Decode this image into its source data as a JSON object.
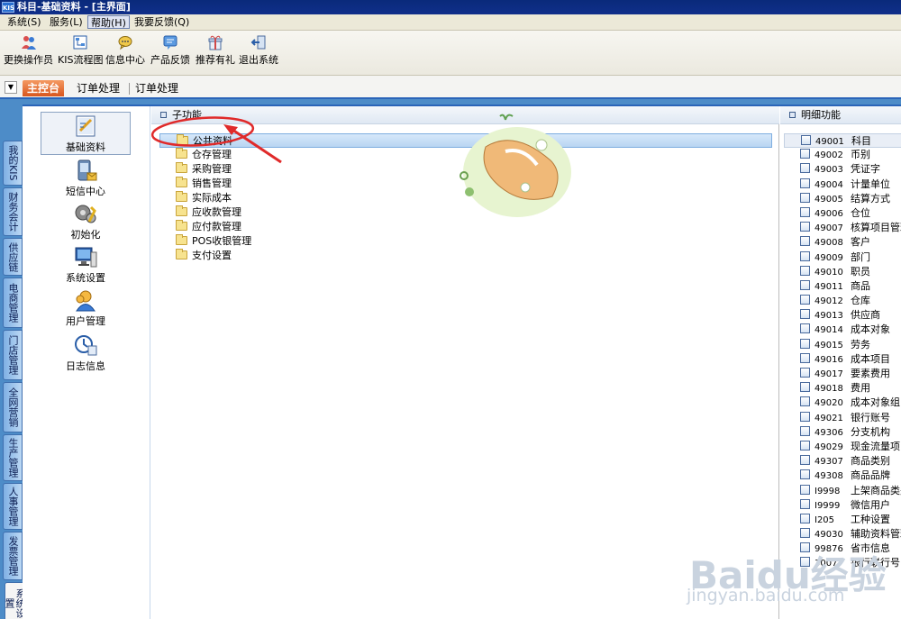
{
  "window": {
    "app_icon": "KIS",
    "title": "科目-基础资料 - [主界面]"
  },
  "menubar": {
    "items": [
      "系统(S)",
      "服务(L)",
      "帮助(H)",
      "我要反馈(Q)"
    ],
    "active_index": 2
  },
  "toolbar": {
    "buttons": [
      {
        "label": "更换操作员",
        "icon": "users-icon"
      },
      {
        "label": "KIS流程图",
        "icon": "flowchart-icon"
      },
      {
        "label": "信息中心",
        "icon": "message-icon"
      },
      {
        "label": "产品反馈",
        "icon": "feedback-icon"
      },
      {
        "label": "推荐有礼",
        "icon": "gift-icon"
      },
      {
        "label": "退出系统",
        "icon": "exit-icon"
      }
    ]
  },
  "tabs": {
    "items": [
      "主控台",
      "订单处理",
      "订单处理"
    ],
    "active_index": 0
  },
  "vertical_tabs": [
    "我的KIS",
    "财务会计",
    "供应链",
    "电商管理",
    "门店管理",
    "全网营销",
    "生产管理",
    "人事管理",
    "发票管理",
    "系统设置"
  ],
  "vertical_tabs_active": 9,
  "left_nav": {
    "items": [
      {
        "label": "基础资料",
        "icon": "basic-data-icon"
      },
      {
        "label": "短信中心",
        "icon": "sms-icon"
      },
      {
        "label": "初始化",
        "icon": "initialize-icon"
      },
      {
        "label": "系统设置",
        "icon": "system-settings-icon"
      },
      {
        "label": "用户管理",
        "icon": "user-management-icon"
      },
      {
        "label": "日志信息",
        "icon": "log-icon"
      }
    ],
    "selected_index": 0
  },
  "sub_functions": {
    "header": "子功能",
    "items": [
      "公共资料",
      "仓存管理",
      "采购管理",
      "销售管理",
      "实际成本",
      "应收款管理",
      "应付款管理",
      "POS收银管理",
      "支付设置"
    ],
    "selected_index": 0
  },
  "detail_functions": {
    "header": "明细功能",
    "items": [
      {
        "code": "49001",
        "name": "科目"
      },
      {
        "code": "49002",
        "name": "币别"
      },
      {
        "code": "49003",
        "name": "凭证字"
      },
      {
        "code": "49004",
        "name": "计量单位"
      },
      {
        "code": "49005",
        "name": "结算方式"
      },
      {
        "code": "49006",
        "name": "仓位"
      },
      {
        "code": "49007",
        "name": "核算项目管理"
      },
      {
        "code": "49008",
        "name": "客户"
      },
      {
        "code": "49009",
        "name": "部门"
      },
      {
        "code": "49010",
        "name": "职员"
      },
      {
        "code": "49011",
        "name": "商品"
      },
      {
        "code": "49012",
        "name": "仓库"
      },
      {
        "code": "49013",
        "name": "供应商"
      },
      {
        "code": "49014",
        "name": "成本对象"
      },
      {
        "code": "49015",
        "name": "劳务"
      },
      {
        "code": "49016",
        "name": "成本项目"
      },
      {
        "code": "49017",
        "name": "要素费用"
      },
      {
        "code": "49018",
        "name": "费用"
      },
      {
        "code": "49020",
        "name": "成本对象组"
      },
      {
        "code": "49021",
        "name": "银行账号"
      },
      {
        "code": "49306",
        "name": "分支机构"
      },
      {
        "code": "49029",
        "name": "现金流量项目"
      },
      {
        "code": "49307",
        "name": "商品类别"
      },
      {
        "code": "49308",
        "name": "商品品牌"
      },
      {
        "code": "I9998",
        "name": "上架商品类别"
      },
      {
        "code": "I9999",
        "name": "微信用户"
      },
      {
        "code": "I205",
        "name": "工种设置"
      },
      {
        "code": "49030",
        "name": "辅助资料管理"
      },
      {
        "code": "99876",
        "name": "省市信息"
      },
      {
        "code": "30077",
        "name": "银行联行号"
      }
    ],
    "selected_index": 0
  },
  "watermark": {
    "brand": "Baidu经验",
    "url": "jingyan.baidu.com"
  },
  "colors": {
    "title_bar": "#0a2a7a",
    "shell_blue": "#4d8cc8",
    "active_tab": "#e0692c",
    "annotation_red": "#e02a2a"
  }
}
